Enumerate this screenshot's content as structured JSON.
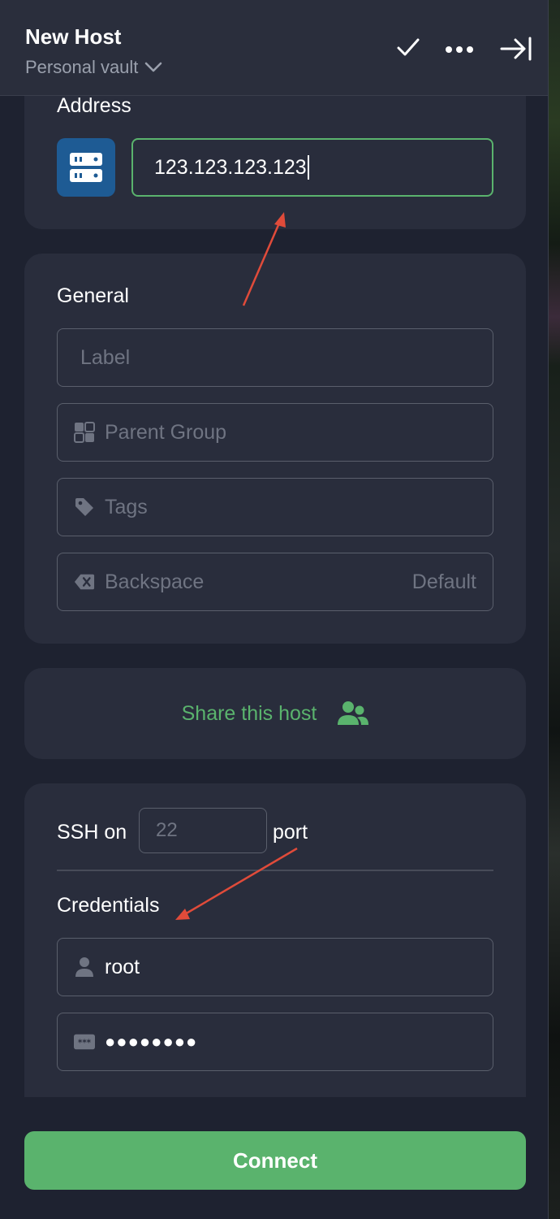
{
  "header": {
    "title": "New Host",
    "vault": "Personal vault"
  },
  "address": {
    "label": "Address",
    "value": "123.123.123.123"
  },
  "general": {
    "label": "General",
    "label_placeholder": "Label",
    "parent_group_placeholder": "Parent Group",
    "tags_placeholder": "Tags",
    "backspace_label": "Backspace",
    "backspace_value": "Default"
  },
  "share": {
    "label": "Share this host"
  },
  "ssh": {
    "prefix": "SSH on",
    "port_placeholder": "22",
    "suffix": "port"
  },
  "credentials": {
    "label": "Credentials",
    "username": "root",
    "password_mask": "●●●●●●●●"
  },
  "connect_label": "Connect",
  "colors": {
    "accent_green": "#5ab36d",
    "panel_bg": "#1e2230",
    "card_bg": "#292d3c",
    "annotation_red": "#e04b3a"
  }
}
